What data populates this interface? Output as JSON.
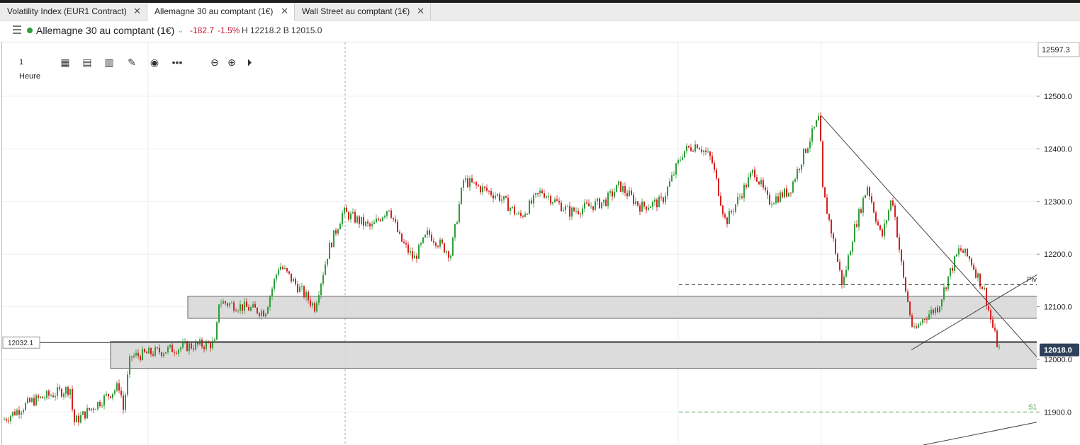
{
  "tabs": [
    {
      "label": "Volatility Index (EUR1 Contract)",
      "active": false
    },
    {
      "label": "Allemagne 30 au comptant (1€)",
      "active": true
    },
    {
      "label": "Wall Street au comptant (1€)",
      "active": false
    }
  ],
  "tab_close_glyph": "✕",
  "header": {
    "instrument": "Allemagne 30 au comptant (1€)",
    "change": "-182.7",
    "change_pct": "-1.5%",
    "high_bid": "H 12218.2  B 12015.0",
    "status_color": "#2e9e3a",
    "negative_color": "#c8102e"
  },
  "toolbar": {
    "timeframe": "1 Heure",
    "icons": [
      "candle-type-icon",
      "indicators-icon",
      "bar-chart-icon",
      "draw-pencil-icon",
      "eye-icon",
      "more-icon",
      "zoom-out-icon",
      "zoom-in-icon",
      "play-forward-icon"
    ]
  },
  "price_axis": {
    "top_value": "12597.3",
    "ticks": [
      "12500.0",
      "12400.0",
      "12300.0",
      "12200.0",
      "12100.0",
      "12000.0",
      "11900.0"
    ],
    "current_price": "12018.0",
    "left_label": "12032.1"
  },
  "annotations": {
    "pivot_label": "Piv",
    "s1_label": "S1"
  },
  "colors": {
    "up": "#2e9e3a",
    "down": "#d62020",
    "zone": "#d9d9d9",
    "s1": "#4aa84a"
  }
}
